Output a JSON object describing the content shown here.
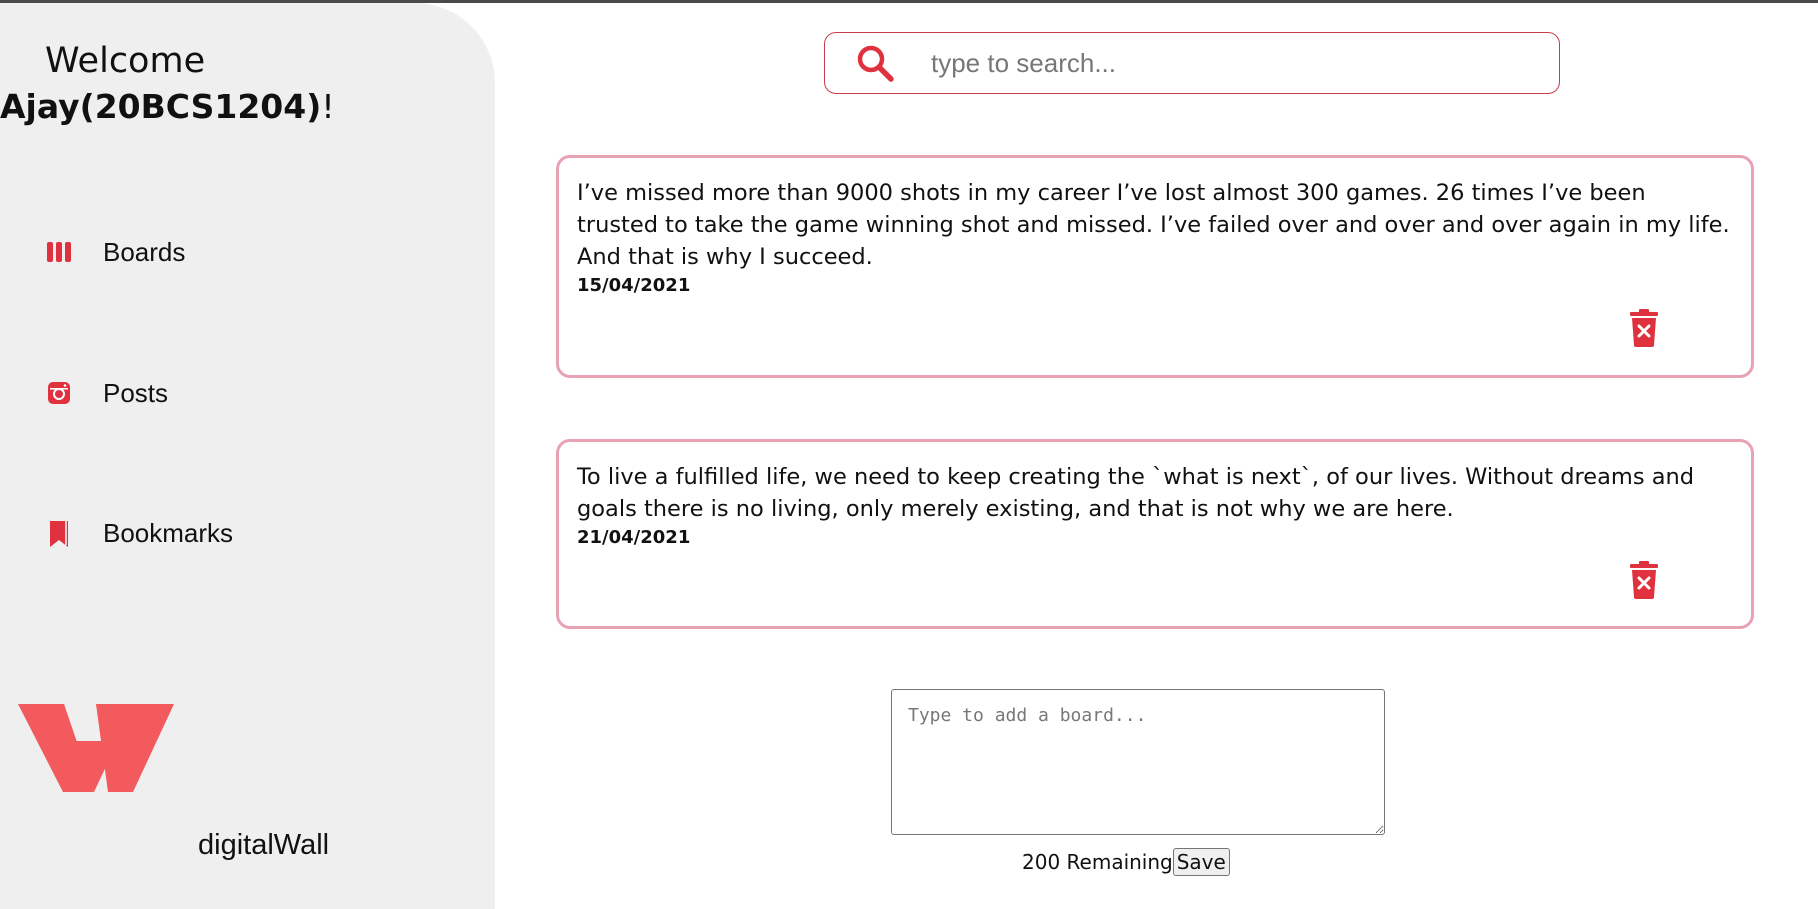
{
  "sidebar": {
    "welcome": "Welcome",
    "user_name": "Ajay(20BCS1204)",
    "exclaim": "!",
    "nav": [
      {
        "label": "Boards",
        "icon": "boards-icon"
      },
      {
        "label": "Posts",
        "icon": "instagram-icon"
      },
      {
        "label": "Bookmarks",
        "icon": "bookmark-icon"
      }
    ],
    "brand": "digitalWall"
  },
  "search": {
    "placeholder": "type to search..."
  },
  "boards": [
    {
      "text": "I’ve missed more than 9000 shots in my career I’ve lost almost 300 games. 26 times I’ve been trusted to take the game winning shot and missed. I’ve failed over and over and over again in my life. And that is why I succeed.",
      "date": "15/04/2021"
    },
    {
      "text": "To live a fulfilled life, we need to keep creating the `what is next`, of our lives. Without dreams and goals there is no living, only merely existing, and that is not why we are here.",
      "date": "21/04/2021"
    }
  ],
  "new_board": {
    "placeholder": "Type to add a board...",
    "remaining": "200 Remaining",
    "save_label": "Save"
  },
  "colors": {
    "accent": "#e0313f",
    "logo": "#f25a5e",
    "card_border": "#e7a2b3",
    "sidebar_bg": "#efefef"
  }
}
